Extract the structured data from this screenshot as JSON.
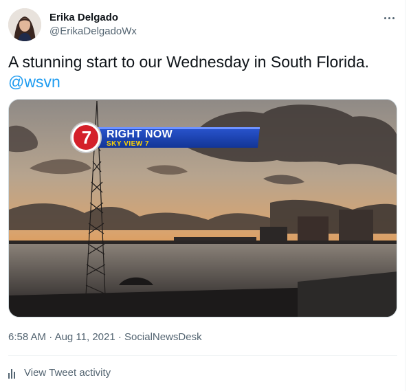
{
  "author": {
    "display_name": "Erika Delgado",
    "handle": "@ErikaDelgadoWx"
  },
  "tweet": {
    "text": "A stunning start to our Wednesday in South Florida.",
    "mention": "@wsvn"
  },
  "media": {
    "overlay_logo": "7",
    "overlay_title": "RIGHT NOW",
    "overlay_subtitle": "SKY VIEW 7",
    "brand_blue": "#1b3fa8",
    "brand_yellow": "#ffd400"
  },
  "meta": {
    "time": "6:58 AM",
    "separator1": "·",
    "date": "Aug 11, 2021",
    "separator2": "·",
    "source": "SocialNewsDesk"
  },
  "activity": {
    "label": "View Tweet activity",
    "icon": "bar-chart-icon"
  },
  "colors": {
    "link": "#1d9bf0",
    "secondary_text": "#536471"
  }
}
